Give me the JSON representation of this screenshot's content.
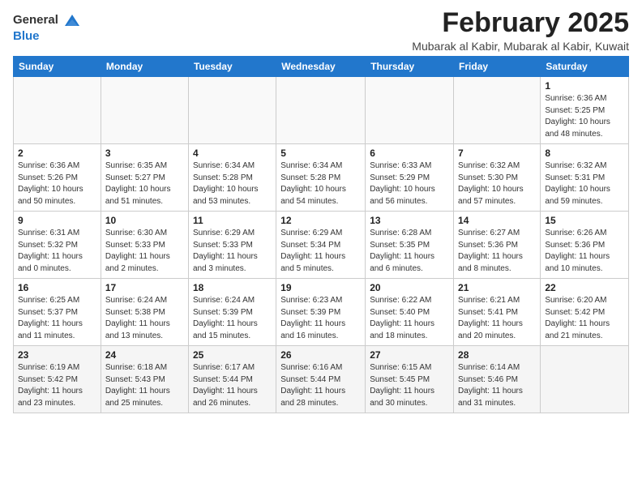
{
  "header": {
    "logo_general": "General",
    "logo_blue": "Blue",
    "month_title": "February 2025",
    "location": "Mubarak al Kabir, Mubarak al Kabir, Kuwait"
  },
  "weekdays": [
    "Sunday",
    "Monday",
    "Tuesday",
    "Wednesday",
    "Thursday",
    "Friday",
    "Saturday"
  ],
  "weeks": [
    [
      {
        "day": "",
        "sunrise": "",
        "sunset": "",
        "daylight": ""
      },
      {
        "day": "",
        "sunrise": "",
        "sunset": "",
        "daylight": ""
      },
      {
        "day": "",
        "sunrise": "",
        "sunset": "",
        "daylight": ""
      },
      {
        "day": "",
        "sunrise": "",
        "sunset": "",
        "daylight": ""
      },
      {
        "day": "",
        "sunrise": "",
        "sunset": "",
        "daylight": ""
      },
      {
        "day": "",
        "sunrise": "",
        "sunset": "",
        "daylight": ""
      },
      {
        "day": "1",
        "sunrise": "6:36 AM",
        "sunset": "5:25 PM",
        "daylight": "10 hours and 48 minutes."
      }
    ],
    [
      {
        "day": "2",
        "sunrise": "6:36 AM",
        "sunset": "5:26 PM",
        "daylight": "10 hours and 50 minutes."
      },
      {
        "day": "3",
        "sunrise": "6:35 AM",
        "sunset": "5:27 PM",
        "daylight": "10 hours and 51 minutes."
      },
      {
        "day": "4",
        "sunrise": "6:34 AM",
        "sunset": "5:28 PM",
        "daylight": "10 hours and 53 minutes."
      },
      {
        "day": "5",
        "sunrise": "6:34 AM",
        "sunset": "5:28 PM",
        "daylight": "10 hours and 54 minutes."
      },
      {
        "day": "6",
        "sunrise": "6:33 AM",
        "sunset": "5:29 PM",
        "daylight": "10 hours and 56 minutes."
      },
      {
        "day": "7",
        "sunrise": "6:32 AM",
        "sunset": "5:30 PM",
        "daylight": "10 hours and 57 minutes."
      },
      {
        "day": "8",
        "sunrise": "6:32 AM",
        "sunset": "5:31 PM",
        "daylight": "10 hours and 59 minutes."
      }
    ],
    [
      {
        "day": "9",
        "sunrise": "6:31 AM",
        "sunset": "5:32 PM",
        "daylight": "11 hours and 0 minutes."
      },
      {
        "day": "10",
        "sunrise": "6:30 AM",
        "sunset": "5:33 PM",
        "daylight": "11 hours and 2 minutes."
      },
      {
        "day": "11",
        "sunrise": "6:29 AM",
        "sunset": "5:33 PM",
        "daylight": "11 hours and 3 minutes."
      },
      {
        "day": "12",
        "sunrise": "6:29 AM",
        "sunset": "5:34 PM",
        "daylight": "11 hours and 5 minutes."
      },
      {
        "day": "13",
        "sunrise": "6:28 AM",
        "sunset": "5:35 PM",
        "daylight": "11 hours and 6 minutes."
      },
      {
        "day": "14",
        "sunrise": "6:27 AM",
        "sunset": "5:36 PM",
        "daylight": "11 hours and 8 minutes."
      },
      {
        "day": "15",
        "sunrise": "6:26 AM",
        "sunset": "5:36 PM",
        "daylight": "11 hours and 10 minutes."
      }
    ],
    [
      {
        "day": "16",
        "sunrise": "6:25 AM",
        "sunset": "5:37 PM",
        "daylight": "11 hours and 11 minutes."
      },
      {
        "day": "17",
        "sunrise": "6:24 AM",
        "sunset": "5:38 PM",
        "daylight": "11 hours and 13 minutes."
      },
      {
        "day": "18",
        "sunrise": "6:24 AM",
        "sunset": "5:39 PM",
        "daylight": "11 hours and 15 minutes."
      },
      {
        "day": "19",
        "sunrise": "6:23 AM",
        "sunset": "5:39 PM",
        "daylight": "11 hours and 16 minutes."
      },
      {
        "day": "20",
        "sunrise": "6:22 AM",
        "sunset": "5:40 PM",
        "daylight": "11 hours and 18 minutes."
      },
      {
        "day": "21",
        "sunrise": "6:21 AM",
        "sunset": "5:41 PM",
        "daylight": "11 hours and 20 minutes."
      },
      {
        "day": "22",
        "sunrise": "6:20 AM",
        "sunset": "5:42 PM",
        "daylight": "11 hours and 21 minutes."
      }
    ],
    [
      {
        "day": "23",
        "sunrise": "6:19 AM",
        "sunset": "5:42 PM",
        "daylight": "11 hours and 23 minutes."
      },
      {
        "day": "24",
        "sunrise": "6:18 AM",
        "sunset": "5:43 PM",
        "daylight": "11 hours and 25 minutes."
      },
      {
        "day": "25",
        "sunrise": "6:17 AM",
        "sunset": "5:44 PM",
        "daylight": "11 hours and 26 minutes."
      },
      {
        "day": "26",
        "sunrise": "6:16 AM",
        "sunset": "5:44 PM",
        "daylight": "11 hours and 28 minutes."
      },
      {
        "day": "27",
        "sunrise": "6:15 AM",
        "sunset": "5:45 PM",
        "daylight": "11 hours and 30 minutes."
      },
      {
        "day": "28",
        "sunrise": "6:14 AM",
        "sunset": "5:46 PM",
        "daylight": "11 hours and 31 minutes."
      },
      {
        "day": "",
        "sunrise": "",
        "sunset": "",
        "daylight": ""
      }
    ]
  ]
}
